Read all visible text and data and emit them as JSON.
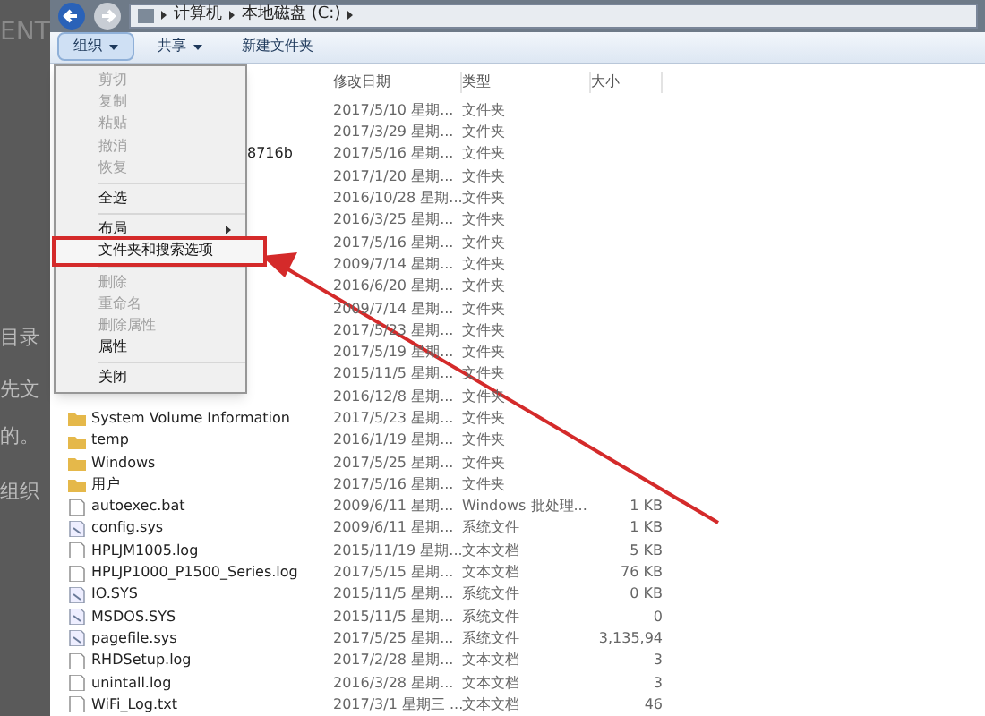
{
  "background_text": [
    "ENT",
    "目录",
    "先文",
    "的。",
    "组织"
  ],
  "address_bar": {
    "crumbs": [
      "计算机",
      "本地磁盘 (C:)"
    ]
  },
  "toolbar": [
    {
      "label": "组织",
      "dropdown": true,
      "selected": true
    },
    {
      "label": "共享",
      "dropdown": true,
      "selected": false
    },
    {
      "label": "新建文件夹",
      "dropdown": false,
      "selected": false
    }
  ],
  "columns": [
    "修改日期",
    "类型",
    "大小"
  ],
  "rows": [
    {
      "date": "2017/5/10 星期...",
      "type": "文件夹"
    },
    {
      "date": "2017/3/29 星期...",
      "type": "文件夹"
    },
    {
      "name": "8716b",
      "date": "2017/5/16 星期...",
      "type": "文件夹"
    },
    {
      "date": "2017/1/20 星期...",
      "type": "文件夹"
    },
    {
      "date": "2016/10/28 星期...",
      "type": "文件夹"
    },
    {
      "date": "2016/3/25 星期...",
      "type": "文件夹"
    },
    {
      "date": "2017/5/16 星期...",
      "type": "文件夹"
    },
    {
      "date": "2009/7/14 星期...",
      "type": "文件夹"
    },
    {
      "date": "2016/6/20 星期...",
      "type": "文件夹"
    },
    {
      "date": "2009/7/14 星期...",
      "type": "文件夹"
    },
    {
      "date": "2017/5/23 星期...",
      "type": "文件夹"
    },
    {
      "date": "2017/5/19 星期...",
      "type": "文件夹"
    },
    {
      "date": "2015/11/5 星期...",
      "type": "文件夹"
    },
    {
      "date": "2016/12/8 星期...",
      "type": "文件夹"
    },
    {
      "kind": "folder",
      "name": "System Volume Information",
      "date": "2017/5/23 星期...",
      "type": "文件夹"
    },
    {
      "kind": "folder",
      "name": "temp",
      "date": "2016/1/19 星期...",
      "type": "文件夹"
    },
    {
      "kind": "folder",
      "name": "Windows",
      "date": "2017/5/25 星期...",
      "type": "文件夹"
    },
    {
      "kind": "folder",
      "name": "用户",
      "date": "2017/5/16 星期...",
      "type": "文件夹"
    },
    {
      "kind": "file",
      "name": "autoexec.bat",
      "date": "2009/6/11 星期...",
      "type": "Windows 批处理...",
      "size": "1 KB"
    },
    {
      "kind": "sys",
      "name": "config.sys",
      "date": "2009/6/11 星期...",
      "type": "系统文件",
      "size": "1 KB"
    },
    {
      "kind": "file",
      "name": "HPLJM1005.log",
      "date": "2015/11/19 星期...",
      "type": "文本文档",
      "size": "5 KB"
    },
    {
      "kind": "file",
      "name": "HPLJP1000_P1500_Series.log",
      "date": "2017/5/15 星期...",
      "type": "文本文档",
      "size": "76 KB"
    },
    {
      "kind": "sys",
      "name": "IO.SYS",
      "date": "2015/11/5 星期...",
      "type": "系统文件",
      "size": "0 KB"
    },
    {
      "kind": "sys",
      "name": "MSDOS.SYS",
      "date": "2015/11/5 星期...",
      "type": "系统文件",
      "size": "0"
    },
    {
      "kind": "sys",
      "name": "pagefile.sys",
      "date": "2017/5/25 星期...",
      "type": "系统文件",
      "size": "3,135,94"
    },
    {
      "kind": "file",
      "name": "RHDSetup.log",
      "date": "2017/2/28 星期...",
      "type": "文本文档",
      "size": "3"
    },
    {
      "kind": "file",
      "name": "unintall.log",
      "date": "2016/3/28 星期...",
      "type": "文本文档",
      "size": "3"
    },
    {
      "kind": "file",
      "name": "WiFi_Log.txt",
      "date": "2017/3/1 星期三 ...",
      "type": "文本文档",
      "size": "46"
    }
  ],
  "menu": [
    {
      "kind": "item",
      "label": "剪切",
      "disabled": true,
      "highlighted": false
    },
    {
      "kind": "item",
      "label": "复制",
      "disabled": true,
      "highlighted": false
    },
    {
      "kind": "item",
      "label": "粘贴",
      "disabled": true,
      "highlighted": false
    },
    {
      "kind": "item",
      "label": "撤消",
      "disabled": true,
      "highlighted": false
    },
    {
      "kind": "item",
      "label": "恢复",
      "disabled": true,
      "highlighted": false
    },
    {
      "kind": "separator"
    },
    {
      "kind": "item",
      "label": "全选",
      "disabled": false,
      "highlighted": false
    },
    {
      "kind": "separator"
    },
    {
      "kind": "submenu",
      "label": "布局",
      "disabled": false,
      "highlighted": false
    },
    {
      "kind": "item",
      "label": "文件夹和搜索选项",
      "disabled": false,
      "highlighted": true
    },
    {
      "kind": "separator"
    },
    {
      "kind": "item",
      "label": "删除",
      "disabled": true,
      "highlighted": false
    },
    {
      "kind": "item",
      "label": "重命名",
      "disabled": true,
      "highlighted": false
    },
    {
      "kind": "item",
      "label": "删除属性",
      "disabled": true,
      "highlighted": false
    },
    {
      "kind": "item",
      "label": "属性",
      "disabled": false,
      "highlighted": false
    },
    {
      "kind": "separator"
    },
    {
      "kind": "item",
      "label": "关闭",
      "disabled": false,
      "highlighted": false
    }
  ]
}
